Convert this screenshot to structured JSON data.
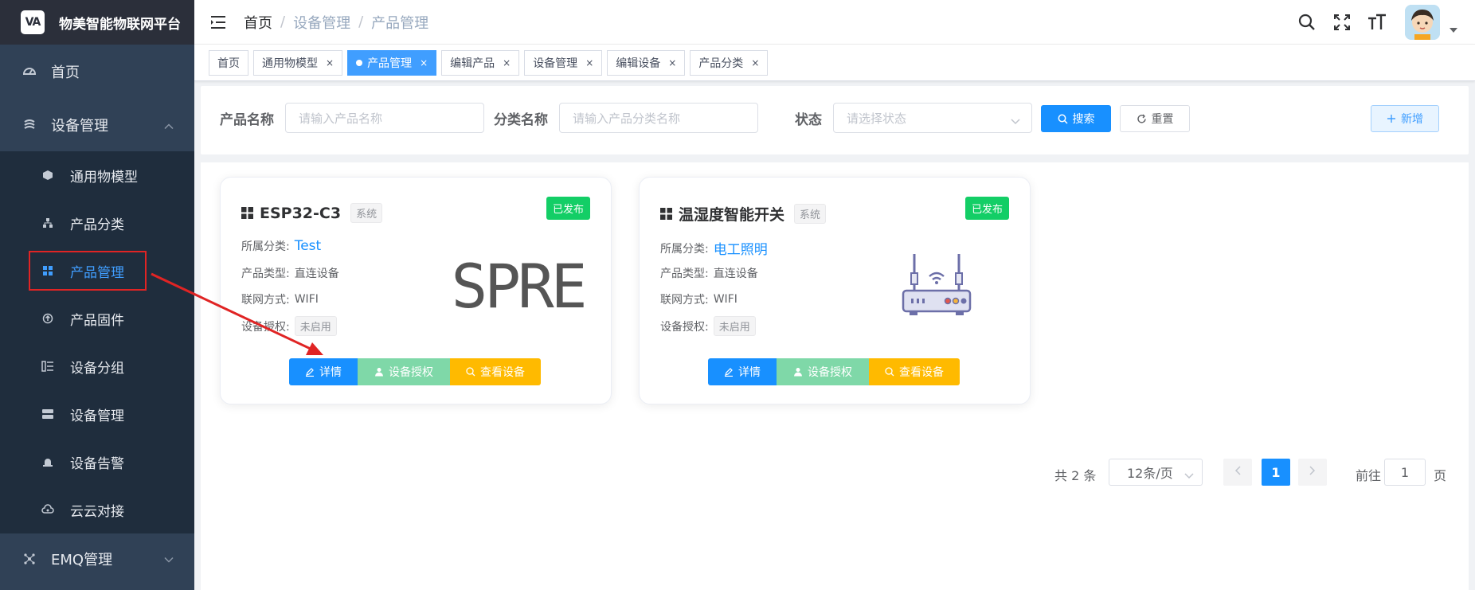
{
  "app": {
    "logo_text": "VA",
    "title": "物美智能物联网平台"
  },
  "sidebar": {
    "items": [
      {
        "label": "首页",
        "icon": "dashboard-icon"
      },
      {
        "label": "设备管理",
        "icon": "layers-icon",
        "expanded": true
      }
    ],
    "subitems": [
      {
        "label": "通用物模型",
        "icon": "cube-icon"
      },
      {
        "label": "产品分类",
        "icon": "tree-icon"
      },
      {
        "label": "产品管理",
        "icon": "grid-icon",
        "active": true
      },
      {
        "label": "产品固件",
        "icon": "upload-circle-icon"
      },
      {
        "label": "设备分组",
        "icon": "group-list-icon"
      },
      {
        "label": "设备管理",
        "icon": "server-icon"
      },
      {
        "label": "设备告警",
        "icon": "alarm-icon"
      },
      {
        "label": "云云对接",
        "icon": "cloud-link-icon"
      }
    ],
    "bottom_item": {
      "label": "EMQ管理",
      "icon": "network-icon"
    }
  },
  "header": {
    "breadcrumb": [
      "首页",
      "设备管理",
      "产品管理"
    ],
    "breadcrumb_sep": "/"
  },
  "tags": [
    {
      "label": "首页",
      "closable": false,
      "active": false
    },
    {
      "label": "通用物模型",
      "closable": true,
      "active": false
    },
    {
      "label": "产品管理",
      "closable": true,
      "active": true
    },
    {
      "label": "编辑产品",
      "closable": true,
      "active": false
    },
    {
      "label": "设备管理",
      "closable": true,
      "active": false
    },
    {
      "label": "编辑设备",
      "closable": true,
      "active": false
    },
    {
      "label": "产品分类",
      "closable": true,
      "active": false
    }
  ],
  "tag_close": "×",
  "search": {
    "product_name_label": "产品名称",
    "product_name_placeholder": "请输入产品名称",
    "category_label": "分类名称",
    "category_placeholder": "请输入产品分类名称",
    "status_label": "状态",
    "status_placeholder": "请选择状态",
    "search_btn": "搜索",
    "reset_btn": "重置",
    "add_btn": "新增"
  },
  "cards": [
    {
      "name": "ESP32-C3",
      "sys_tag": "系统",
      "status": "已发布",
      "category_label": "所属分类:",
      "category": "Test",
      "type_label": "产品类型:",
      "type": "直连设备",
      "network_label": "联网方式:",
      "network": "WIFI",
      "auth_label": "设备授权:",
      "auth": "未启用",
      "image_text": "SPRE",
      "actions": {
        "detail": "详情",
        "auth": "设备授权",
        "view": "查看设备"
      }
    },
    {
      "name": "温湿度智能开关",
      "sys_tag": "系统",
      "status": "已发布",
      "category_label": "所属分类:",
      "category": "电工照明",
      "type_label": "产品类型:",
      "type": "直连设备",
      "network_label": "联网方式:",
      "network": "WIFI",
      "auth_label": "设备授权:",
      "auth": "未启用",
      "image_icon": "router-icon",
      "actions": {
        "detail": "详情",
        "auth": "设备授权",
        "view": "查看设备"
      }
    }
  ],
  "pagination": {
    "total": "共 2 条",
    "page_size": "12条/页",
    "current_page": "1",
    "goto_label": "前往",
    "goto_value": "1",
    "page_unit": "页"
  },
  "colors": {
    "sidebar_bg": "#304156",
    "submenu_bg": "#1f2d3d",
    "primary": "#1890ff",
    "success": "#13ce66",
    "warning": "#ffba00",
    "annotation_red": "#e02424"
  }
}
